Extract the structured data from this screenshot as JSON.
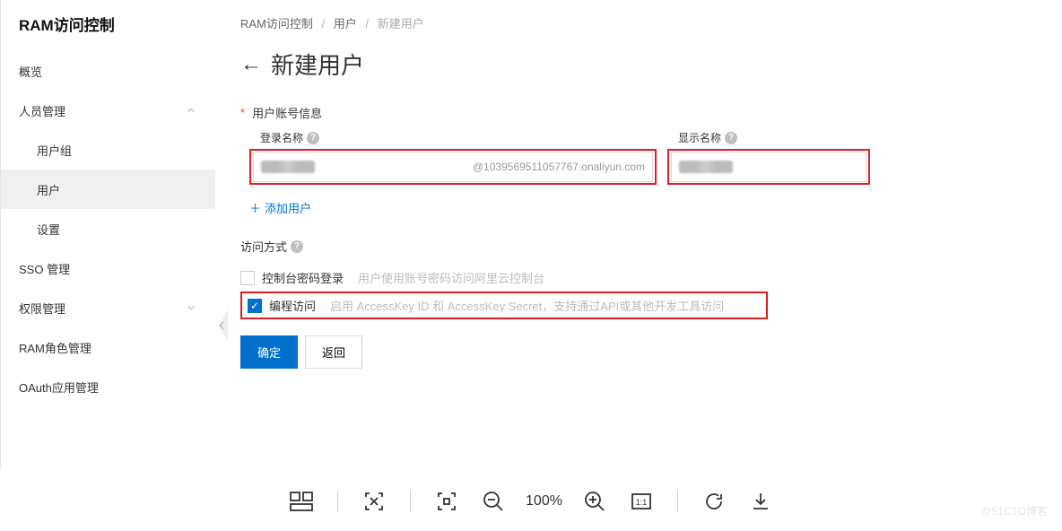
{
  "sidebar": {
    "title": "RAM访问控制",
    "items": [
      {
        "label": "概览"
      },
      {
        "label": "人员管理",
        "expanded": true
      },
      {
        "label": "用户组",
        "sub": true
      },
      {
        "label": "用户",
        "sub": true,
        "active": true
      },
      {
        "label": "设置",
        "sub": true
      },
      {
        "label": "SSO 管理"
      },
      {
        "label": "权限管理",
        "expandable": true
      },
      {
        "label": "RAM角色管理"
      },
      {
        "label": "OAuth应用管理"
      }
    ]
  },
  "breadcrumb": {
    "root": "RAM访问控制",
    "mid": "用户",
    "current": "新建用户"
  },
  "pageTitle": "新建用户",
  "accountSection": {
    "label": "用户账号信息",
    "loginName": {
      "label": "登录名称",
      "suffix": "@1039569511057767.onaliyun.com"
    },
    "displayName": {
      "label": "显示名称"
    },
    "addUser": "添加用户"
  },
  "accessSection": {
    "label": "访问方式",
    "console": {
      "label": "控制台密码登录",
      "desc": "用户使用账号密码访问阿里云控制台"
    },
    "program": {
      "label": "编程访问",
      "desc": "启用 AccessKey ID 和 AccessKey Secret，支持通过API或其他开发工具访问"
    }
  },
  "buttons": {
    "confirm": "确定",
    "back": "返回"
  },
  "toolbar": {
    "zoom": "100%"
  },
  "watermark": "@51CTO博客"
}
